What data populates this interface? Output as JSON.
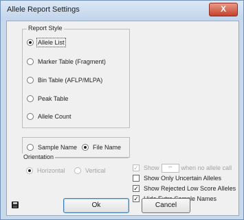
{
  "window": {
    "title": "Allele Report Settings",
    "close_label": "X"
  },
  "report_style": {
    "label": "Report Style",
    "options": [
      {
        "label": "Allele List",
        "selected": true
      },
      {
        "label": "Marker Table (Fragment)",
        "selected": false
      },
      {
        "label": "Bin Table (AFLP/MLPA)",
        "selected": false
      },
      {
        "label": "Peak Table",
        "selected": false
      },
      {
        "label": "Allele Count",
        "selected": false
      }
    ]
  },
  "naming": {
    "options": [
      {
        "label": "Sample Name",
        "selected": false
      },
      {
        "label": "File Name",
        "selected": true
      }
    ]
  },
  "orientation": {
    "label": "Orientation",
    "enabled": false,
    "options": [
      {
        "label": "Horizontal",
        "selected": true
      },
      {
        "label": "Vertical",
        "selected": false
      }
    ]
  },
  "show_missing": {
    "prefix": "Show",
    "value": "**",
    "suffix": "when no allele call",
    "checked": true,
    "enabled": false
  },
  "checkboxes": [
    {
      "label": "Show Only Uncertain Alleles",
      "checked": false
    },
    {
      "label": "Show Rejected Low Score Alleles",
      "checked": true
    },
    {
      "label": "Hide Extra Sample Names",
      "checked": true
    }
  ],
  "buttons": {
    "ok": "Ok",
    "cancel": "Cancel"
  },
  "icons": {
    "save": "floppy-disk-icon",
    "close": "close-icon"
  }
}
